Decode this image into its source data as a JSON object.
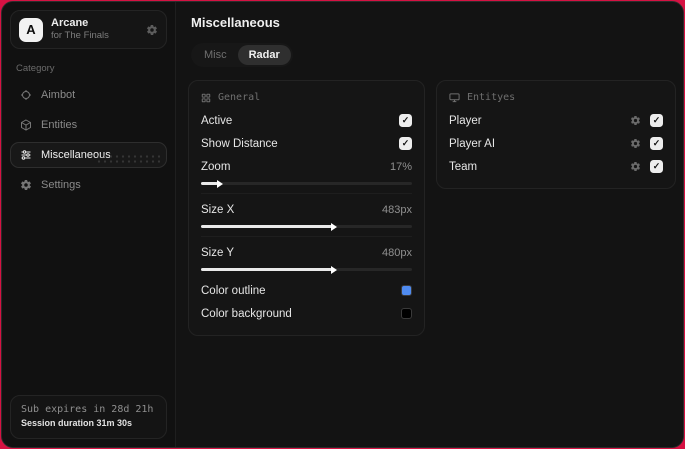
{
  "sidebar": {
    "brand": {
      "logo_letter": "A",
      "title": "Arcane",
      "subtitle": "for The Finals"
    },
    "category_label": "Category",
    "items": [
      {
        "label": "Aimbot",
        "icon": "crosshair-icon",
        "active": false
      },
      {
        "label": "Entities",
        "icon": "cube-icon",
        "active": false
      },
      {
        "label": "Miscellaneous",
        "icon": "sliders-icon",
        "active": true
      },
      {
        "label": "Settings",
        "icon": "gear-icon",
        "active": false
      }
    ],
    "subscription": {
      "expires_text": "Sub expires in 28d 21h",
      "session_text": "Session duration 31m 30s"
    }
  },
  "main": {
    "title": "Miscellaneous",
    "tabs": [
      {
        "label": "Misc",
        "active": false
      },
      {
        "label": "Radar",
        "active": true
      }
    ],
    "general": {
      "title": "General",
      "toggles": [
        {
          "label": "Active",
          "checked": true
        },
        {
          "label": "Show Distance",
          "checked": true
        }
      ],
      "sliders": [
        {
          "label": "Zoom",
          "value": "17%",
          "fill_percent": 8
        },
        {
          "label": "Size X",
          "value": "483px",
          "fill_percent": 62
        },
        {
          "label": "Size Y",
          "value": "480px",
          "fill_percent": 62
        }
      ],
      "color_rows": [
        {
          "label": "Color outline",
          "color": "#4f8bf0"
        },
        {
          "label": "Color background",
          "color": "#000000"
        }
      ]
    },
    "entities": {
      "title": "Entityes",
      "rows": [
        {
          "label": "Player",
          "checked": true
        },
        {
          "label": "Player AI",
          "checked": true
        },
        {
          "label": "Team",
          "checked": true
        }
      ]
    }
  },
  "colors": {
    "frame_accent": "#d61243",
    "outline_swatch": "#4f8bf0",
    "background_swatch": "#000000"
  },
  "glyphs": {
    "check": "✓"
  }
}
